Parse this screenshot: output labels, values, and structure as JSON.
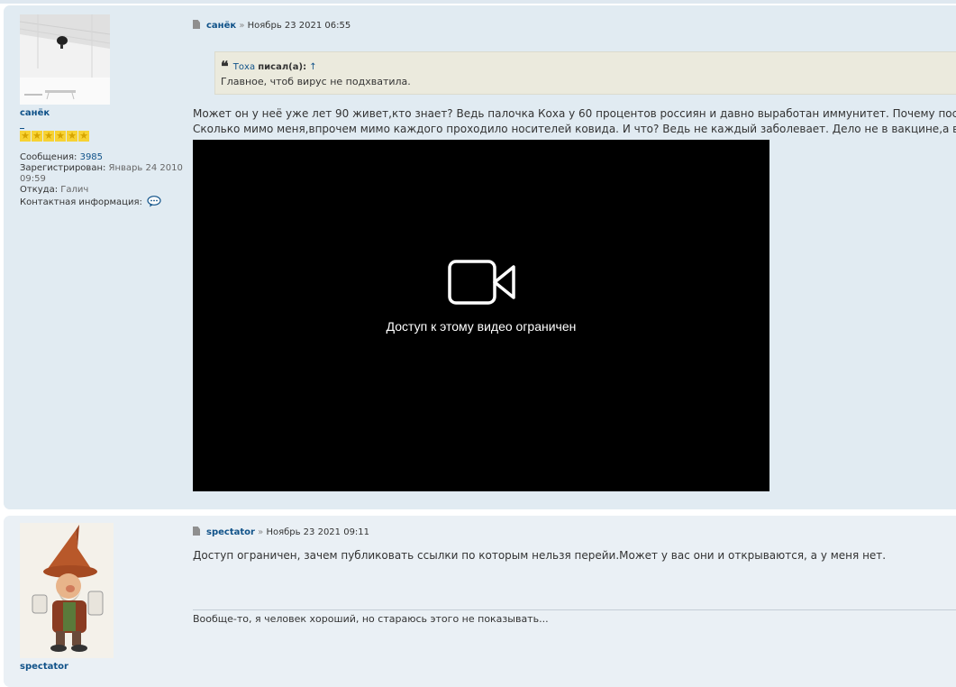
{
  "posts": [
    {
      "author": "санёк",
      "avatar": "avatar-photo-white-room",
      "rank_stars": 6,
      "stats": {
        "messages_label": "Сообщения:",
        "messages_value": "3985",
        "registered_label": "Зарегистрирован:",
        "registered_value_line1": "Январь 24 2010",
        "registered_value_line2": "09:59",
        "from_label": "Откуда:",
        "from_value": "Галич",
        "contact_label": "Контактная информация:"
      },
      "header": {
        "author": "санёк",
        "separator": "»",
        "date": "Ноябрь 23 2021 06:55"
      },
      "quote": {
        "author": "Тоха",
        "wrote": "писал(а):",
        "arrow": "↑",
        "text": "Главное, чтоб вирус не подхватила."
      },
      "text_line1": "Может он у неё уже лет 90 живет,кто знает? Ведь палочка Коха у 60 процентов россиян и давно выработан иммунитет. Почему после приви",
      "text_line2": "Сколько мимо меня,впрочем мимо каждого проходило носителей ковида. И что? Ведь не каждый заболевает. Дело не в вакцине,а в иммун",
      "video": {
        "message": "Доступ к этому видео ограничен",
        "icon": "video-camera-icon"
      }
    },
    {
      "author": "spectator",
      "avatar": "avatar-gnome-illustration",
      "header": {
        "author": "spectator",
        "separator": "»",
        "date": "Ноябрь 23 2021 09:11"
      },
      "text": "Доступ ограничен, зачем публиковать ссылки по которым нельзя перейи.Может у вас они и открываются, а у меня нет.",
      "signature": "Вообще-то, я человек хороший, но стараюсь этого не показывать..."
    }
  ],
  "colors": {
    "link": "#105289",
    "post_bg_1": "#e1ebf2",
    "post_bg_2": "#eaf0f5",
    "quote_bg": "#ebeadd",
    "video_bg": "#000000"
  }
}
